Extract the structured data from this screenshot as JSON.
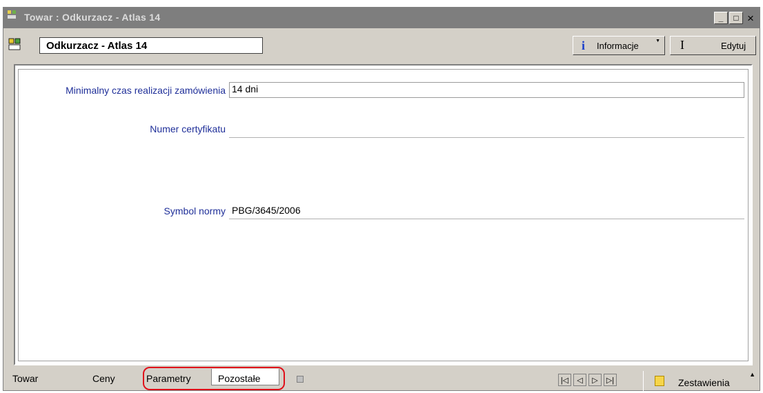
{
  "window": {
    "title": "Towar : Odkurzacz - Atlas 14",
    "controls": {
      "minimize": "_",
      "maximize": "□",
      "close": "×"
    }
  },
  "toolbar": {
    "record_name": "Odkurzacz - Atlas 14",
    "info_label": "Informacje",
    "edit_label": "Edytuj"
  },
  "fields": [
    {
      "label": "Minimalny czas realizacji zamówienia",
      "value": "14 dni"
    },
    {
      "label": "Numer certyfikatu",
      "value": ""
    },
    {
      "label": "Symbol normy",
      "value": "PBG/3645/2006"
    }
  ],
  "tabs": [
    "Towar",
    "Ceny",
    "Parametry",
    "Pozostałe"
  ],
  "active_tab": "Pozostałe",
  "nav": {
    "first": "|◁",
    "prev": "◁",
    "next": "▷",
    "last": "▷|"
  },
  "summary_label": "Zestawienia",
  "colors": {
    "highlight": "#e0101a",
    "label_text": "#1f2f99"
  }
}
